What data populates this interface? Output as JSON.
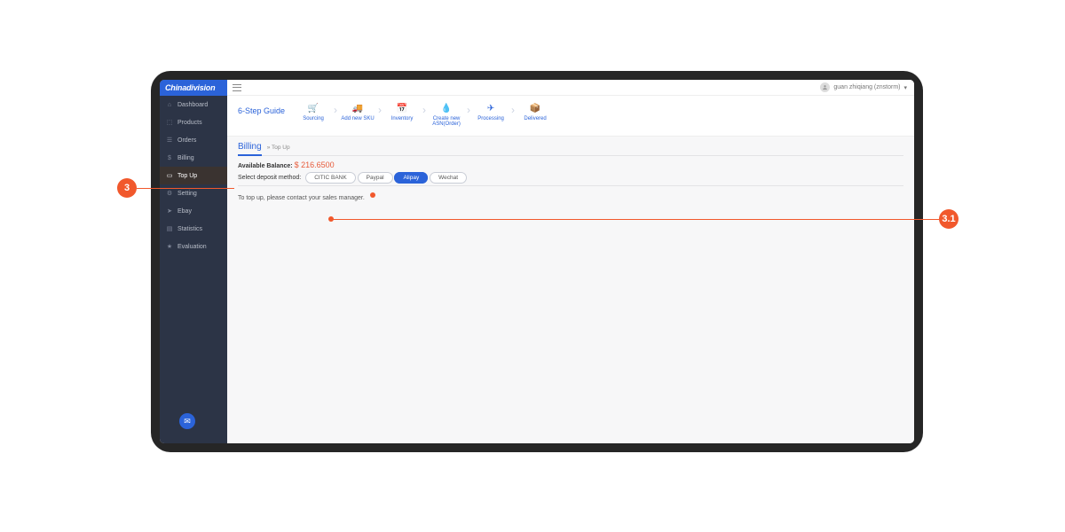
{
  "brand": "Chinadivision",
  "user": {
    "name": "guan zhiqiang (znstorm)",
    "dropdown_glyph": "▾"
  },
  "sidebar": {
    "items": [
      {
        "icon": "⌂",
        "label": "Dashboard",
        "name": "sidebar-item-dashboard"
      },
      {
        "icon": "⬚",
        "label": "Products",
        "name": "sidebar-item-products"
      },
      {
        "icon": "☰",
        "label": "Orders",
        "name": "sidebar-item-orders"
      },
      {
        "icon": "$",
        "label": "Billing",
        "name": "sidebar-item-billing"
      },
      {
        "icon": "▭",
        "label": "Top Up",
        "name": "sidebar-item-topup",
        "active": true
      },
      {
        "icon": "⚙",
        "label": "Setting",
        "name": "sidebar-item-setting"
      },
      {
        "icon": "➤",
        "label": "Ebay",
        "name": "sidebar-item-ebay"
      },
      {
        "icon": "▤",
        "label": "Statistics",
        "name": "sidebar-item-statistics"
      },
      {
        "icon": "★",
        "label": "Evaluation",
        "name": "sidebar-item-evaluation"
      }
    ]
  },
  "guide": {
    "title": "6-Step Guide",
    "steps": [
      {
        "icon": "🛒",
        "label": "Sourcing"
      },
      {
        "icon": "🚚",
        "label": "Add new SKU"
      },
      {
        "icon": "📅",
        "label": "Inventory"
      },
      {
        "icon": "💧",
        "label": "Create new ASN(Order)"
      },
      {
        "icon": "✈",
        "label": "Processing"
      },
      {
        "icon": "📦",
        "label": "Delivered"
      }
    ]
  },
  "page": {
    "title": "Billing",
    "crumb": "» Top Up",
    "balance_label": "Available Balance:",
    "balance_value": "$ 216.6500",
    "method_label": "Select deposit method:",
    "methods": [
      {
        "label": "CITIC BANK",
        "selected": false
      },
      {
        "label": "Paypal",
        "selected": false
      },
      {
        "label": "Alipay",
        "selected": true
      },
      {
        "label": "Wechat",
        "selected": false
      }
    ],
    "note": "To top up, please contact your sales manager."
  },
  "annotations": {
    "left": {
      "text": "3"
    },
    "right": {
      "text": "3.1"
    }
  },
  "colors": {
    "accent": "#2b63d9",
    "callout": "#f1582c",
    "balance": "#e75b3a"
  }
}
